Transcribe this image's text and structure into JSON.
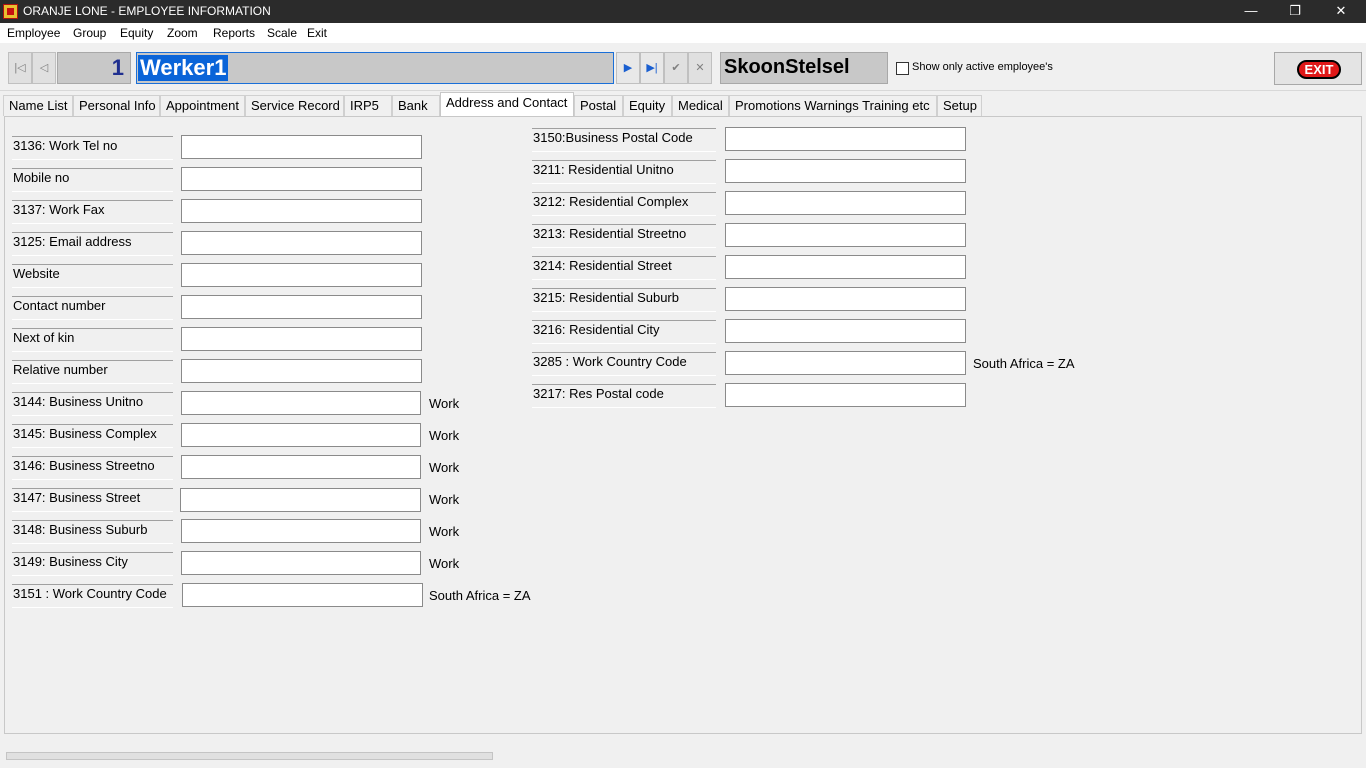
{
  "window": {
    "title": "ORANJE LONE - EMPLOYEE INFORMATION",
    "minimize": "—",
    "restore": "❐",
    "close": "✕"
  },
  "menu": [
    "Employee",
    "Group",
    "Equity",
    "Zoom",
    "Reports",
    "Scale",
    "Exit"
  ],
  "toolbar": {
    "first": "|◁",
    "prev": "◁",
    "record_no": "1",
    "employee_name": "Werker1",
    "next": "▶",
    "last": "▶|",
    "confirm": "✔",
    "cancel": "✕",
    "company": "SkoonStelsel",
    "show_active_label": "Show only active employee's",
    "exit_label": "EXIT"
  },
  "tabs": [
    {
      "label": "Name List",
      "active": false
    },
    {
      "label": "Personal Info",
      "active": false
    },
    {
      "label": "Appointment",
      "active": false
    },
    {
      "label": "Service Record",
      "active": false
    },
    {
      "label": "IRP5",
      "active": false
    },
    {
      "label": "Bank",
      "active": false
    },
    {
      "label": "Address and Contact",
      "active": true
    },
    {
      "label": "Postal",
      "active": false
    },
    {
      "label": "Equity",
      "active": false
    },
    {
      "label": "Medical",
      "active": false
    },
    {
      "label": "Promotions Warnings Training etc",
      "active": false
    },
    {
      "label": "Setup",
      "active": false
    }
  ],
  "left_fields": [
    {
      "label": "3136:  Work Tel no",
      "value": "",
      "note": ""
    },
    {
      "label": "Mobile no",
      "value": "",
      "note": ""
    },
    {
      "label": "3137:  Work Fax",
      "value": "",
      "note": ""
    },
    {
      "label": "3125:  Email address",
      "value": "",
      "note": ""
    },
    {
      "label": "Website",
      "value": "",
      "note": ""
    },
    {
      "label": "Contact number",
      "value": "",
      "note": ""
    },
    {
      "label": "Next of kin",
      "value": "",
      "note": ""
    },
    {
      "label": "Relative number",
      "value": "",
      "note": ""
    },
    {
      "label": "3144:  Business Unitno",
      "value": "",
      "note": "Work"
    },
    {
      "label": "3145:  Business Complex",
      "value": "",
      "note": "Work"
    },
    {
      "label": "3146:  Business Streetno",
      "value": "",
      "note": "Work"
    },
    {
      "label": "3147:  Business Street",
      "value": "",
      "note": "Work"
    },
    {
      "label": "3148:  Business Suburb",
      "value": "",
      "note": "Work"
    },
    {
      "label": "3149:  Business City",
      "value": "",
      "note": "Work"
    },
    {
      "label": "3151 : Work Country Code",
      "value": "",
      "note": "South Africa = ZA"
    }
  ],
  "right_fields": [
    {
      "label": "3150:Business Postal Code",
      "value": "",
      "note": ""
    },
    {
      "label": "3211:  Residential Unitno",
      "value": "",
      "note": ""
    },
    {
      "label": "3212:  Residential Complex",
      "value": "",
      "note": ""
    },
    {
      "label": "3213:  Residential Streetno",
      "value": "",
      "note": ""
    },
    {
      "label": "3214:  Residential Street",
      "value": "",
      "note": ""
    },
    {
      "label": "3215:  Residential Suburb",
      "value": "",
      "note": ""
    },
    {
      "label": "3216:  Residential City",
      "value": "",
      "note": ""
    },
    {
      "label": "3285 : Work Country Code",
      "value": "",
      "note": "South Africa = ZA"
    },
    {
      "label": "3217:  Res Postal code",
      "value": "",
      "note": ""
    }
  ]
}
